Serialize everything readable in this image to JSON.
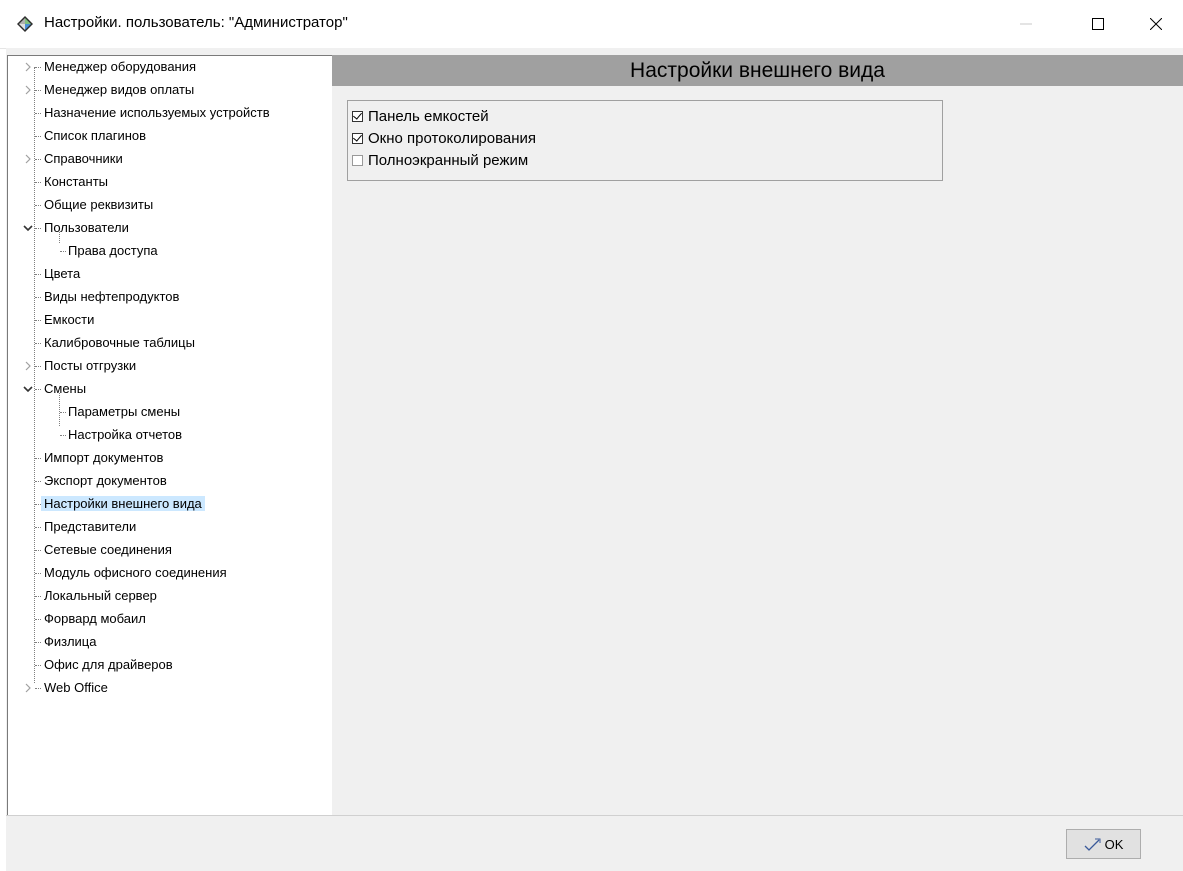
{
  "window": {
    "title": "Настройки. пользователь: \"Администратор\""
  },
  "tree": {
    "items": [
      {
        "label": "Менеджер оборудования",
        "level": 0,
        "toggle": "collapsed"
      },
      {
        "label": "Менеджер видов оплаты",
        "level": 0,
        "toggle": "collapsed"
      },
      {
        "label": "Назначение используемых устройств",
        "level": 0,
        "toggle": "none"
      },
      {
        "label": "Список плагинов",
        "level": 0,
        "toggle": "none"
      },
      {
        "label": "Справочники",
        "level": 0,
        "toggle": "collapsed"
      },
      {
        "label": "Константы",
        "level": 0,
        "toggle": "none"
      },
      {
        "label": "Общие реквизиты",
        "level": 0,
        "toggle": "none"
      },
      {
        "label": "Пользователи",
        "level": 0,
        "toggle": "expanded"
      },
      {
        "label": "Права доступа",
        "level": 1,
        "toggle": "none"
      },
      {
        "label": "Цвета",
        "level": 0,
        "toggle": "none"
      },
      {
        "label": "Виды нефтепродуктов",
        "level": 0,
        "toggle": "none"
      },
      {
        "label": "Емкости",
        "level": 0,
        "toggle": "none"
      },
      {
        "label": "Калибровочные таблицы",
        "level": 0,
        "toggle": "none"
      },
      {
        "label": "Посты отгрузки",
        "level": 0,
        "toggle": "collapsed"
      },
      {
        "label": "Смены",
        "level": 0,
        "toggle": "expanded"
      },
      {
        "label": "Параметры смены",
        "level": 1,
        "toggle": "none"
      },
      {
        "label": "Настройка отчетов",
        "level": 1,
        "toggle": "none"
      },
      {
        "label": "Импорт документов",
        "level": 0,
        "toggle": "none"
      },
      {
        "label": "Экспорт документов",
        "level": 0,
        "toggle": "none"
      },
      {
        "label": "Настройки внешнего вида",
        "level": 0,
        "toggle": "none",
        "selected": true
      },
      {
        "label": "Представители",
        "level": 0,
        "toggle": "none"
      },
      {
        "label": "Сетевые соединения",
        "level": 0,
        "toggle": "none"
      },
      {
        "label": "Модуль офисного соединения",
        "level": 0,
        "toggle": "none"
      },
      {
        "label": "Локальный сервер",
        "level": 0,
        "toggle": "none"
      },
      {
        "label": "Форвард мобаил",
        "level": 0,
        "toggle": "none"
      },
      {
        "label": "Физлица",
        "level": 0,
        "toggle": "none"
      },
      {
        "label": "Офис для драйверов",
        "level": 0,
        "toggle": "none"
      },
      {
        "label": "Web Office",
        "level": 0,
        "toggle": "collapsed"
      }
    ]
  },
  "panel": {
    "title": "Настройки внешнего вида",
    "options": [
      {
        "label": "Панель емкостей",
        "checked": true
      },
      {
        "label": "Окно протоколирования",
        "checked": true
      },
      {
        "label": "Полноэкранный режим",
        "checked": false
      }
    ]
  },
  "footer": {
    "ok_label": "OK"
  },
  "colors": {
    "header_bg": "#a0a0a0",
    "selection_bg": "#cce8ff",
    "window_bg": "#f0f0f0"
  }
}
